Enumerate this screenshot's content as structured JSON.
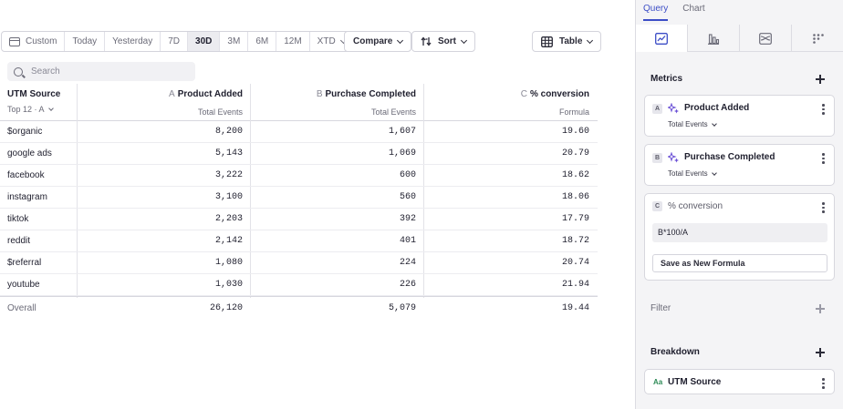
{
  "toolbar": {
    "date_ranges": [
      "Custom",
      "Today",
      "Yesterday",
      "7D",
      "30D",
      "3M",
      "6M",
      "12M",
      "XTD"
    ],
    "active_range": "30D",
    "compare_label": "Compare",
    "sort_label": "Sort",
    "view_label": "Table"
  },
  "search": {
    "placeholder": "Search"
  },
  "table": {
    "breakdown_header": "UTM Source",
    "breakdown_sub": "Top 12 · A",
    "columns": [
      {
        "letter": "A",
        "title": "Product Added",
        "sub": "Total Events"
      },
      {
        "letter": "B",
        "title": "Purchase Completed",
        "sub": "Total Events"
      },
      {
        "letter": "C",
        "title": "% conversion",
        "sub": "Formula"
      }
    ],
    "rows": [
      {
        "name": "$organic",
        "a": "8,200",
        "b": "1,607",
        "c": "19.60"
      },
      {
        "name": "google ads",
        "a": "5,143",
        "b": "1,069",
        "c": "20.79"
      },
      {
        "name": "facebook",
        "a": "3,222",
        "b": "600",
        "c": "18.62"
      },
      {
        "name": "instagram",
        "a": "3,100",
        "b": "560",
        "c": "18.06"
      },
      {
        "name": "tiktok",
        "a": "2,203",
        "b": "392",
        "c": "17.79"
      },
      {
        "name": "reddit",
        "a": "2,142",
        "b": "401",
        "c": "18.72"
      },
      {
        "name": "$referral",
        "a": "1,080",
        "b": "224",
        "c": "20.74"
      },
      {
        "name": "youtube",
        "a": "1,030",
        "b": "226",
        "c": "21.94"
      }
    ],
    "overall": {
      "name": "Overall",
      "a": "26,120",
      "b": "5,079",
      "c": "19.44"
    }
  },
  "panel": {
    "tabs": [
      "Query",
      "Chart"
    ],
    "active_tab": "Query",
    "chart_types": [
      "line-chart-icon",
      "bar-chart-icon",
      "flow-chart-icon",
      "dots-grid-icon"
    ],
    "metrics_title": "Metrics",
    "metrics": [
      {
        "letter": "A",
        "name": "Product Added",
        "measure": "Total Events"
      },
      {
        "letter": "B",
        "name": "Purchase Completed",
        "measure": "Total Events"
      }
    ],
    "formula": {
      "letter": "C",
      "name": "% conversion",
      "expression": "B*100/A",
      "save_label": "Save as New Formula"
    },
    "filter_title": "Filter",
    "breakdown_title": "Breakdown",
    "breakdown": {
      "type_label": "Aa",
      "name": "UTM Source"
    }
  },
  "colors": {
    "accent": "#3c4dc6",
    "text_type": "#2e8b57",
    "panel_bg": "#f4f4f6"
  }
}
